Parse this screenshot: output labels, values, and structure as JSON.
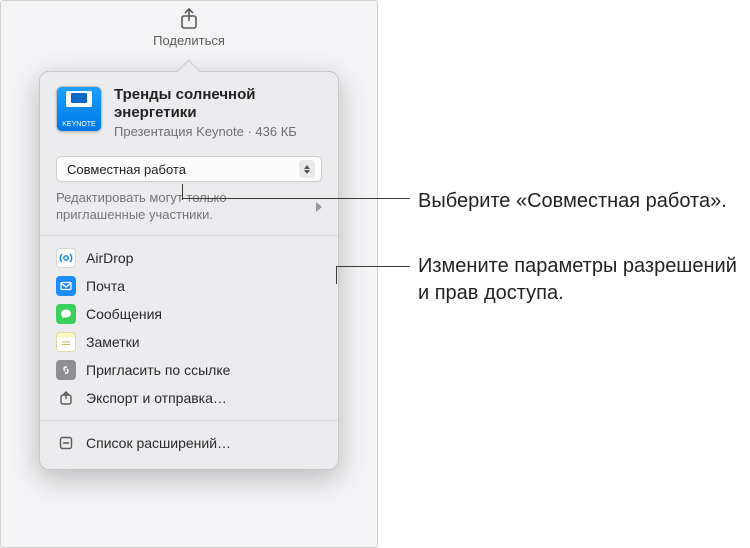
{
  "toolbar": {
    "share_label": "Поделиться"
  },
  "doc": {
    "thumb_badge": "KEYNOTE",
    "title": "Тренды солнечной энергетики",
    "subtitle": "Презентация Keynote · 436 КБ"
  },
  "mode": {
    "selected": "Совместная работа"
  },
  "permissions": {
    "text": "Редактировать могут только приглашенные участники."
  },
  "share_items": [
    {
      "id": "airdrop",
      "label": "AirDrop"
    },
    {
      "id": "mail",
      "label": "Почта"
    },
    {
      "id": "messages",
      "label": "Сообщения"
    },
    {
      "id": "notes",
      "label": "Заметки"
    },
    {
      "id": "link",
      "label": "Пригласить по ссылке"
    },
    {
      "id": "export",
      "label": "Экспорт и отправка…"
    }
  ],
  "extensions": {
    "label": "Список расширений…"
  },
  "callouts": {
    "c1": "Выберите «Совместная работа».",
    "c2": "Измените параметры разрешений и прав доступа."
  }
}
